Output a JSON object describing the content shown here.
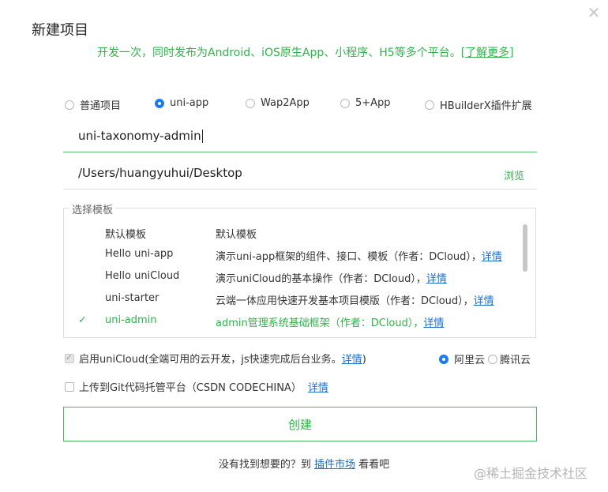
{
  "dialog": {
    "title": "新建项目",
    "subtitle_text": "开发一次，同时发布为Android、iOS原生App、小程序、H5等多个平台。",
    "subtitle_link": "[了解更多]"
  },
  "project_types": [
    {
      "label": "普通项目",
      "selected": false
    },
    {
      "label": "uni-app",
      "selected": true
    },
    {
      "label": "Wap2App",
      "selected": false
    },
    {
      "label": "5+App",
      "selected": false
    },
    {
      "label": "HBuilderX插件扩展",
      "selected": false
    }
  ],
  "project_name": {
    "value": "uni-taxonomy-admin"
  },
  "project_path": {
    "value": "/Users/huangyuhui/Desktop",
    "browse_label": "浏览"
  },
  "templates": {
    "legend": "选择模板",
    "items": [
      {
        "name": "默认模板",
        "desc": "默认模板",
        "link": "",
        "selected": false
      },
      {
        "name": "Hello uni-app",
        "desc": "演示uni-app框架的组件、接口、模板（作者：DCloud），",
        "link": "详情",
        "selected": false
      },
      {
        "name": "Hello uniCloud",
        "desc": "演示uniCloud的基本操作（作者：DCloud），",
        "link": "详情",
        "selected": false
      },
      {
        "name": "uni-starter",
        "desc": "云端一体应用快速开发基本项目模版（作者：DCloud），",
        "link": "详情",
        "selected": false
      },
      {
        "name": "uni-admin",
        "desc": "admin管理系统基础框架（作者：DCloud），",
        "link": "详情",
        "selected": true
      }
    ]
  },
  "unicloud": {
    "label": "启用uniCloud(全端可用的云开发，js快速完成后台业务。",
    "link": "详情",
    "suffix": ")",
    "checked": true,
    "providers": [
      {
        "label": "阿里云",
        "selected": true
      },
      {
        "label": "腾讯云",
        "selected": false
      }
    ]
  },
  "git_upload": {
    "label": "上传到Git代码托管平台（CSDN CODECHINA）",
    "link": "详情",
    "checked": false
  },
  "create_button": {
    "label": "创建"
  },
  "bottom": {
    "prefix": "没有找到想要的？到",
    "link": "插件市场",
    "suffix": "看看吧"
  },
  "watermark": "@稀土掘金技术社区",
  "colors": {
    "accent_green": "#2fb34a",
    "radio_blue": "#1a7cf5",
    "link_blue": "#1a6fd0"
  }
}
